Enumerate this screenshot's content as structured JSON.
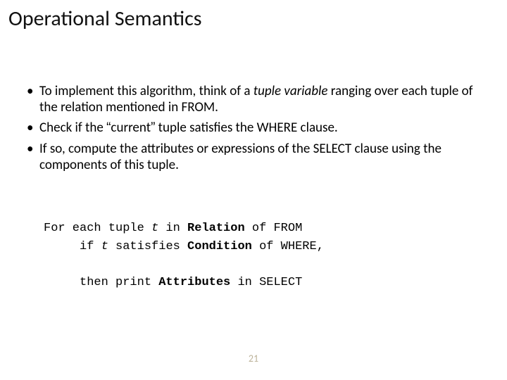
{
  "title": "Operational Semantics",
  "bullets": {
    "b1": {
      "pre": "To implement this algorithm, think of a ",
      "em": "tuple variable",
      "post": "  ranging over each tuple of the relation mentioned in FROM."
    },
    "b2": {
      "pre": "Check if the ",
      "lq": "“",
      "mid": "current",
      "rq": "”",
      "post": " tuple satisfies the WHERE clause."
    },
    "b3": "If so, compute the attributes or expressions of the SELECT clause using the components of this tuple."
  },
  "code": {
    "l1a": "For each tuple ",
    "l1t": "t",
    "l1b": " in ",
    "l1rel": "Relation",
    "l1c": " of FROM",
    "l2a": "     if ",
    "l2t": "t",
    "l2b": " satisfies ",
    "l2cond": "Condition",
    "l2c": " of WHERE,",
    "l3a": "     then print ",
    "l3attr": "Attributes",
    "l3b": " in SELECT"
  },
  "page": "21"
}
